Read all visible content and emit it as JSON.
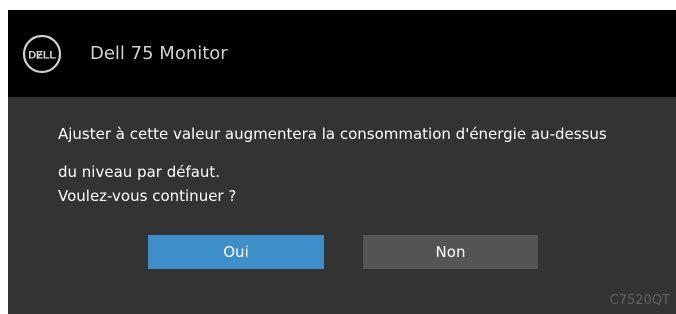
{
  "header": {
    "logo_text": "DELL",
    "title": "Dell 75 Monitor"
  },
  "dialog": {
    "message_line1": "Ajuster à cette valeur augmentera la consommation d'énergie au-dessus",
    "message_line2": "du niveau par défaut.",
    "message_line3": "Voulez-vous continuer ?",
    "yes_label": "Oui",
    "no_label": "Non",
    "model_code": "C7520QT"
  },
  "colors": {
    "header_bg": "#000000",
    "body_bg": "#333333",
    "yes_button": "#3d8ec9",
    "no_button": "#545454"
  }
}
